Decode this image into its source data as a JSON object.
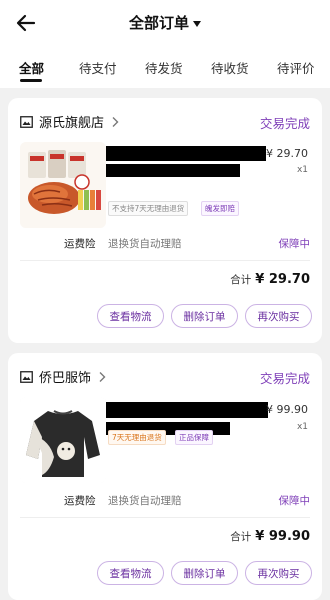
{
  "header": {
    "title": "全部订单",
    "back_icon": "arrow-left-icon",
    "title_caret_icon": "caret-down-icon"
  },
  "tabs": [
    {
      "label": "全部",
      "active": true
    },
    {
      "label": "待支付",
      "active": false
    },
    {
      "label": "待发货",
      "active": false
    },
    {
      "label": "待收货",
      "active": false
    },
    {
      "label": "待评价",
      "active": false
    }
  ],
  "colors": {
    "accent": "#7f3fb8",
    "button_text": "#6a2fa0",
    "button_border": "#cbb3e4",
    "page_bg": "#f1f1f1"
  },
  "orders": [
    {
      "shop_name": "源氏旗舰店",
      "status": "交易完成",
      "price": "¥ 29.70",
      "qty": "x1",
      "tags": [
        "不支持7天无理由退货",
        "魄发即赔"
      ],
      "insurance_label": "运费险",
      "insurance_text": "退换货自动理赔",
      "insurance_status": "保障中",
      "total_label": "合计",
      "total_value": "¥ 29.70",
      "buttons": [
        "查看物流",
        "删除订单",
        "再次购买"
      ]
    },
    {
      "shop_name": "侨巴服饰",
      "status": "交易完成",
      "price": "¥ 99.90",
      "qty": "x1",
      "tags": [
        "7天无理由退货",
        "正品保障"
      ],
      "insurance_label": "运费险",
      "insurance_text": "退换货自动理赔",
      "insurance_status": "保障中",
      "total_label": "合计",
      "total_value": "¥ 99.90",
      "buttons": [
        "查看物流",
        "删除订单",
        "再次购买"
      ]
    }
  ]
}
